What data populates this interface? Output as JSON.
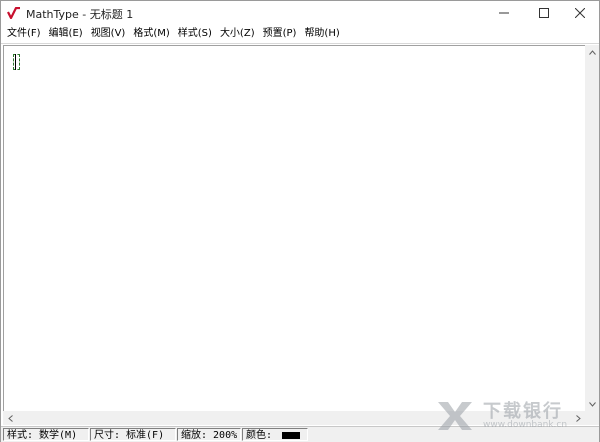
{
  "window": {
    "title": "MathType - 无标题 1"
  },
  "menubar": {
    "items": [
      "文件(F)",
      "编辑(E)",
      "视图(V)",
      "格式(M)",
      "样式(S)",
      "大小(Z)",
      "预置(P)",
      "帮助(H)"
    ]
  },
  "statusbar": {
    "style": "样式: 数学(M)",
    "size": "尺寸: 标准(F)",
    "zoom": "缩放: 200%",
    "color_label": "颜色:",
    "color_value": "#000000"
  },
  "watermark": {
    "title": "下载银行",
    "url": "www.downbank.cn"
  },
  "colors": {
    "logo_red": "#c8102e",
    "slot_green": "#2f7a2f"
  }
}
